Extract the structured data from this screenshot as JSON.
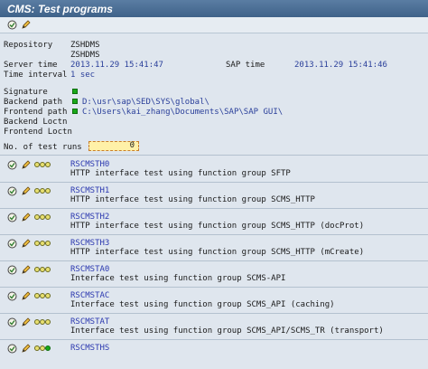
{
  "window": {
    "title": "CMS: Test programs"
  },
  "info": {
    "repository_label": "Repository",
    "repository_value": "ZSHDMS",
    "repository_value2": "ZSHDMS",
    "server_time_label": "Server time",
    "server_time_value": "2013.11.29 15:41:47",
    "sap_time_label": "SAP time",
    "sap_time_value": "2013.11.29 15:41:46",
    "time_interval_label": "Time interval",
    "time_interval_value": "1 sec"
  },
  "paths": {
    "signature_label": "Signature",
    "backend_label": "Backend path",
    "backend_value": "D:\\usr\\sap\\SED\\SYS\\global\\",
    "frontend_label": "Frontend path",
    "frontend_value": "C:\\Users\\kai_zhang\\Documents\\SAP\\SAP GUI\\",
    "backend_loc_label": "Backend Loctn",
    "frontend_loc_label": "Frontend Loctn"
  },
  "runs": {
    "label": "No. of test runs",
    "value": "0"
  },
  "programs": [
    {
      "code": "RSCMSTH0",
      "desc": "HTTP interface test using function group SFTP"
    },
    {
      "code": "RSCMSTH1",
      "desc": "HTTP interface test using function group SCMS_HTTP"
    },
    {
      "code": "RSCMSTH2",
      "desc": "HTTP interface test using function group SCMS_HTTP (docProt)"
    },
    {
      "code": "RSCMSTH3",
      "desc": "HTTP interface test using function group SCMS_HTTP (mCreate)"
    },
    {
      "code": "RSCMSTA0",
      "desc": "Interface test using function group SCMS-API"
    },
    {
      "code": "RSCMSTAC",
      "desc": "Interface test using function group SCMS_API (caching)"
    },
    {
      "code": "RSCMSTAT",
      "desc": "Interface test using function group SCMS_API/SCMS_TR (transport)"
    },
    {
      "code": "RSCMSTHS",
      "desc": ""
    }
  ],
  "colors": {
    "status_green": "#18a818",
    "link_blue": "#2c39b0",
    "value_blue": "#2a3f9a"
  }
}
